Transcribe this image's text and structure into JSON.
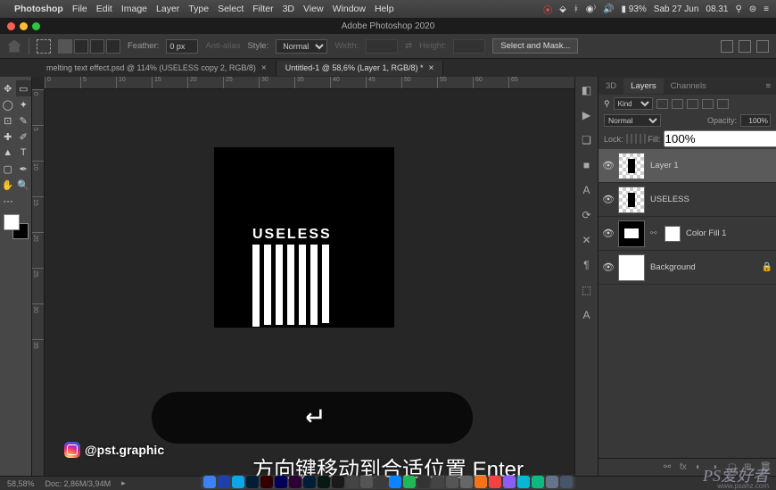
{
  "mac_menu": {
    "app": "Photoshop",
    "items": [
      "File",
      "Edit",
      "Image",
      "Layer",
      "Type",
      "Select",
      "Filter",
      "3D",
      "View",
      "Window",
      "Help"
    ],
    "battery": "93%",
    "date": "Sab 27 Jun",
    "time": "08.31"
  },
  "app_title": "Adobe Photoshop 2020",
  "options": {
    "feather_label": "Feather:",
    "feather_value": "0 px",
    "antialias_label": "Anti-alias",
    "style_label": "Style:",
    "style_value": "Normal",
    "width_label": "Width:",
    "height_label": "Height:",
    "select_mask": "Select and Mask..."
  },
  "tabs": [
    {
      "label": "melting text effect.psd @ 114% (USELESS copy 2, RGB/8)",
      "active": false
    },
    {
      "label": "Untitled-1 @ 58,6% (Layer 1, RGB/8) *",
      "active": true
    }
  ],
  "ruler_marks_h": [
    "0",
    "5",
    "10",
    "15",
    "20",
    "25",
    "30",
    "35",
    "40",
    "45",
    "50",
    "55",
    "60",
    "65"
  ],
  "ruler_marks_v": [
    "0",
    "5",
    "10",
    "15",
    "20",
    "25",
    "30",
    "35"
  ],
  "artwork_text": "USELESS",
  "panel_icons": [
    "◧",
    "▶",
    "❏",
    "■",
    "A",
    "⟳",
    "✕",
    "¶",
    "⬚",
    "A"
  ],
  "layers_panel": {
    "tabs": [
      "3D",
      "Layers",
      "Channels"
    ],
    "active_tab": "Layers",
    "kind_label": "Kind",
    "blend_mode": "Normal",
    "opacity_label": "Opacity:",
    "opacity_value": "100%",
    "lock_label": "Lock:",
    "fill_label": "Fill:",
    "fill_value": "100%",
    "layers": [
      {
        "name": "Layer 1",
        "visible": true,
        "selected": true,
        "type": "raster-trans"
      },
      {
        "name": "USELESS",
        "visible": true,
        "selected": false,
        "type": "raster-trans"
      },
      {
        "name": "Color Fill 1",
        "visible": true,
        "selected": false,
        "type": "fill"
      },
      {
        "name": "Background",
        "visible": true,
        "selected": false,
        "type": "bg",
        "locked": true
      }
    ]
  },
  "status": {
    "zoom": "58,58%",
    "doc": "Doc: 2,86M/3,94M"
  },
  "overlay": {
    "handle": "@pst.graphic",
    "subtitle": "方向键移动到合适位置 Enter"
  },
  "watermark": {
    "text": "PS爱好者",
    "url": "www.psahz.com"
  },
  "dock_colors": [
    "#3b82f6",
    "#1e40af",
    "#0ea5e9",
    "#001e36",
    "#330000",
    "#00005b",
    "#2d0036",
    "#001e36",
    "#071a12",
    "#1a1a1a",
    "#444",
    "#555",
    "#3b3b3b",
    "#0a84ff",
    "#1db954",
    "#333",
    "#444",
    "#555",
    "#666",
    "#f97316",
    "#ef4444",
    "#8b5cf6",
    "#06b6d4",
    "#10b981",
    "#64748b",
    "#475569"
  ]
}
